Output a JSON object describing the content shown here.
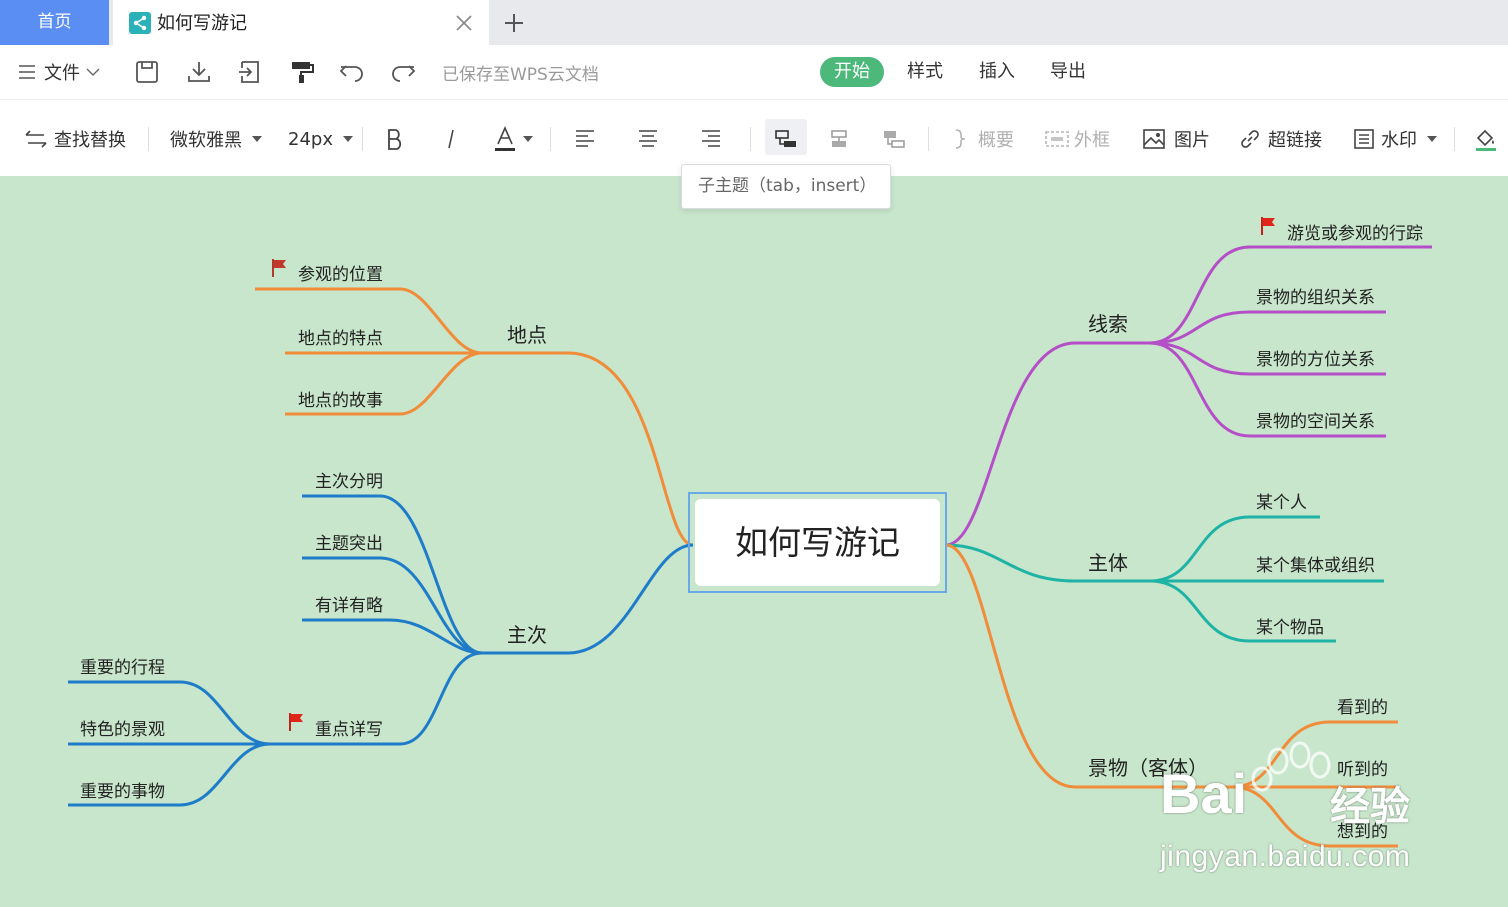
{
  "tabs": {
    "home_label": "首页",
    "doc_title": "如何写游记"
  },
  "menubar": {
    "file_label": "文件",
    "saved_status": "已保存至WPS云文档",
    "tabs": [
      "开始",
      "样式",
      "插入",
      "导出"
    ],
    "active_tab": "开始"
  },
  "toolbar": {
    "find_replace": "查找替换",
    "font_family": "微软雅黑",
    "font_size": "24px",
    "summary": "概要",
    "outer_frame": "外框",
    "image": "图片",
    "hyperlink": "超链接",
    "watermark": "水印"
  },
  "tooltip": "子主题（tab，insert）",
  "mindmap": {
    "root": "如何写游记",
    "branches": {
      "didian": {
        "label": "地点",
        "color": "#f08c3a",
        "children": [
          "参观的位置",
          "地点的特点",
          "地点的故事"
        ]
      },
      "zhuci": {
        "label": "主次",
        "color": "#1e7cc8",
        "children": [
          "主次分明",
          "主题突出",
          "有详有略"
        ],
        "sub": {
          "label": "重点详写",
          "children": [
            "重要的行程",
            "特色的景观",
            "重要的事物"
          ]
        }
      },
      "xiansuo": {
        "label": "线索",
        "color": "#b44fc8",
        "children": [
          "游览或参观的行踪",
          "景物的组织关系",
          "景物的方位关系",
          "景物的空间关系"
        ]
      },
      "zhuti": {
        "label": "主体",
        "color": "#1fb3a6",
        "children": [
          "某个人",
          "某个集体或组织",
          "某个物品"
        ]
      },
      "jingwu": {
        "label": "景物（客体）",
        "color": "#f08c3a",
        "children": [
          "看到的",
          "听到的",
          "想到的"
        ]
      }
    },
    "flag_color": "#e0251b",
    "background": "#c8e6cb"
  },
  "watermark": {
    "brand": "Bai",
    "cn": "经验",
    "url": "jingyan.baidu.com"
  }
}
